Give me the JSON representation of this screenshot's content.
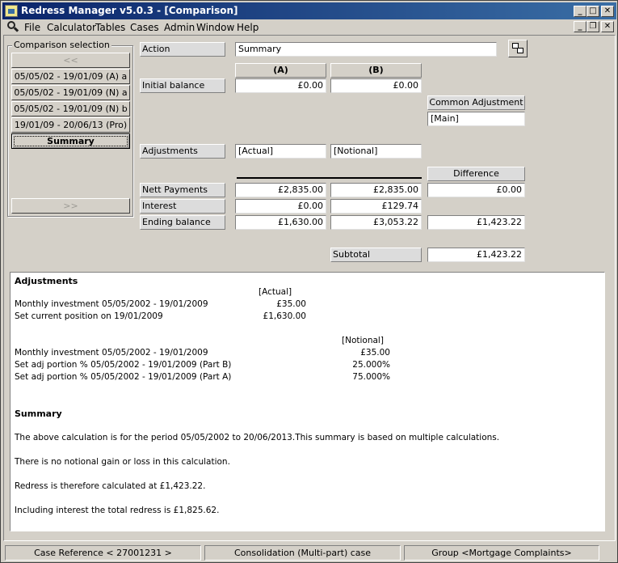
{
  "window": {
    "title": "Redress Manager v5.0.3 - [Comparison]",
    "controls": {
      "minimize": "_",
      "maximize": "□",
      "close": "✕"
    },
    "mdi_controls": {
      "minimize": "_",
      "restore": "❐",
      "close": "✕"
    }
  },
  "menu": [
    "File",
    "Calculator",
    "Tables",
    "Cases",
    "Admin",
    "Window",
    "Help"
  ],
  "comparison": {
    "group_title": "Comparison selection",
    "prev": "<<",
    "next": ">>",
    "items": [
      "05/05/02 - 19/01/09 (A) a",
      "05/05/02 - 19/01/09 (N) a",
      "05/05/02 - 19/01/09 (N) b",
      "19/01/09 - 20/06/13 (Pro)",
      "Summary"
    ],
    "selected": "Summary"
  },
  "form": {
    "action_label": "Action",
    "action_value": "Summary",
    "col_a": "(A)",
    "col_b": "(B)",
    "initial_balance_label": "Initial balance",
    "initial_a": "£0.00",
    "initial_b": "£0.00",
    "common_adj_label": "Common Adjustment",
    "common_adj_value": "[Main]",
    "adjustments_label": "Adjustments",
    "adj_a": "[Actual]",
    "adj_b": "[Notional]",
    "difference_label": "Difference",
    "nett_payments_label": "Nett Payments",
    "nett_a": "£2,835.00",
    "nett_b": "£2,835.00",
    "nett_diff": "£0.00",
    "interest_label": "Interest",
    "interest_a": "£0.00",
    "interest_b": "£129.74",
    "ending_label": "Ending balance",
    "ending_a": "£1,630.00",
    "ending_b": "£3,053.22",
    "ending_diff": "£1,423.22",
    "subtotal_label": "Subtotal",
    "subtotal_value": "£1,423.22"
  },
  "report": {
    "adjustments_heading": "Adjustments",
    "actual_heading": "[Actual]",
    "actual_rows": [
      {
        "label": "Monthly investment 05/05/2002 - 19/01/2009",
        "value": "£35.00"
      },
      {
        "label": "Set current position on 19/01/2009",
        "value": "£1,630.00"
      }
    ],
    "notional_heading": "[Notional]",
    "notional_rows": [
      {
        "label": "Monthly investment 05/05/2002 - 19/01/2009",
        "value": "£35.00"
      },
      {
        "label": "Set adj portion % 05/05/2002 - 19/01/2009  (Part B)",
        "value": "25.000%"
      },
      {
        "label": "Set adj portion % 05/05/2002 - 19/01/2009  (Part A)",
        "value": "75.000%"
      }
    ],
    "summary_heading": "Summary",
    "summary_lines": [
      "The above calculation is for the period 05/05/2002 to 20/06/2013.This summary is based on multiple calculations.",
      "There is no notional gain or loss in this calculation.",
      "Redress is therefore calculated at £1,423.22.",
      "Including interest the total redress is £1,825.62."
    ]
  },
  "status": {
    "case_reference": "Case Reference < 27001231 >",
    "case_type": "Consolidation (Multi-part) case",
    "group": "Group <Mortgage Complaints>"
  }
}
